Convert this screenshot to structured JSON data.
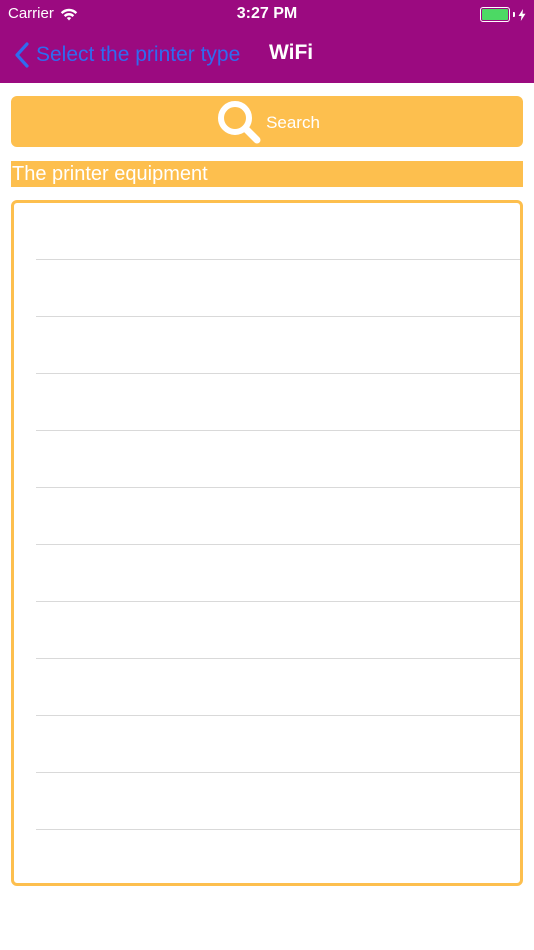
{
  "status_bar": {
    "carrier": "Carrier",
    "time": "3:27 PM",
    "battery_color": "#4cd964"
  },
  "nav": {
    "back_label": "Select the printer type",
    "title": "WiFi",
    "bar_color": "#9b0a80",
    "back_color": "#2f6bf0"
  },
  "search": {
    "label": "Search",
    "icon": "search-icon",
    "color": "#fdbf4e"
  },
  "section": {
    "title": "The printer equipment"
  },
  "list": {
    "row_count": 12
  }
}
